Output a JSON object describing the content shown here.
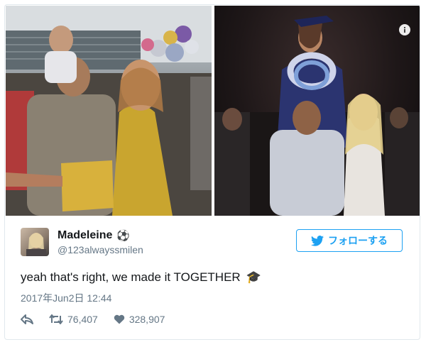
{
  "media": {
    "info_icon": "info-icon"
  },
  "tweet": {
    "display_name": "Madeleine",
    "name_emoji": "⚽",
    "handle": "@123alwayssmilen",
    "follow_label": "フォローする",
    "text": "yeah that's right, we made it TOGETHER",
    "text_emoji": "🎓",
    "timestamp": "2017年Jun2日 12:44",
    "retweet_count": "76,407",
    "like_count": "328,907"
  },
  "colors": {
    "accent": "#1da1f2",
    "muted": "#657786",
    "text": "#14171a"
  }
}
